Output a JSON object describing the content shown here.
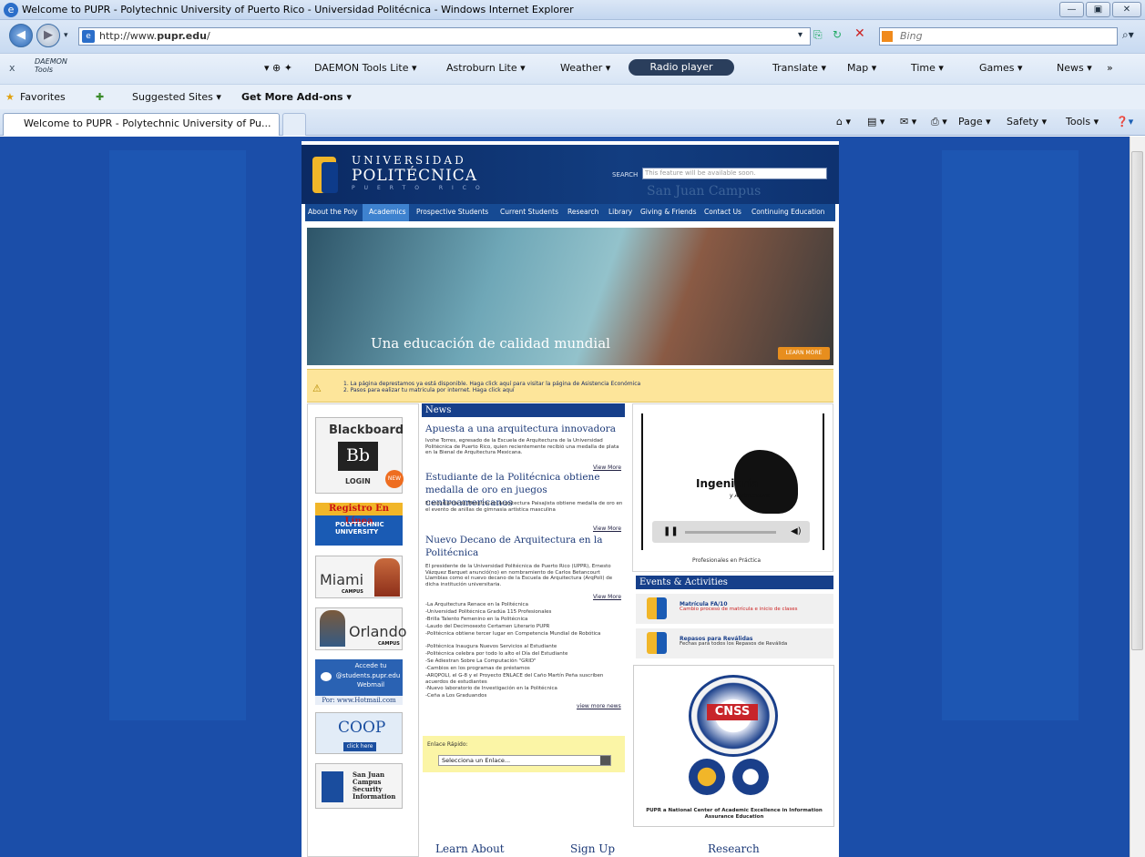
{
  "window": {
    "title": "Welcome to PUPR - Polytechnic University of Puerto Rico - Universidad Politécnica - Windows Internet Explorer"
  },
  "address": {
    "url_prefix": "http://www.",
    "url_domain": "pupr.edu",
    "url_suffix": "/",
    "search_placeholder": "Bing"
  },
  "toolbar": {
    "close": "x",
    "daemon_logo": "DAEMON Tools",
    "daemon_lite": "DAEMON Tools Lite ▾",
    "astroburn": "Astroburn Lite ▾",
    "weather": "Weather ▾",
    "radio": "Radio player",
    "translate": "Translate ▾",
    "map": "Map ▾",
    "time": "Time ▾",
    "games": "Games ▾",
    "news": "News ▾",
    "more": "»"
  },
  "favorites": {
    "favorites": "Favorites",
    "suggested": "Suggested Sites ▾",
    "addons": "Get More Add-ons ▾"
  },
  "tabs": [
    {
      "label": "Welcome to PUPR - Polytechnic University of Pu..."
    }
  ],
  "commandbar": {
    "page": "Page ▾",
    "safety": "Safety ▾",
    "tools": "Tools ▾"
  },
  "site": {
    "univ_line1": "UNIVERSIDAD",
    "univ_line2": "POLITÉCNICA",
    "univ_line3": "PUERTO RICO",
    "search_label": "SEARCH",
    "search_placeholder": "This feature will be available soon.",
    "campus": "San Juan Campus",
    "nav": [
      "About the Poly",
      "Academics",
      "Prospective Students",
      "Current Students",
      "Research",
      "Library",
      "Giving & Friends",
      "Contact Us",
      "Continuing Education"
    ],
    "hero_caption": "Una educación de calidad mundial",
    "hero_button": "LEARN MORE",
    "notice": [
      "1.  La página deprestamos ya está disponible. Haga click aquí para visitar la página de Asistencia Económica",
      "2.  Pasos para ealizar tu matricula por internet. Haga click aquí"
    ],
    "left": {
      "blackboard": "Blackboard",
      "bb": "Bb",
      "login": "LOGIN",
      "new": "NEW",
      "registro": "Registro En Línea",
      "registro_sub": "POLYTECHNIC UNIVERSITY",
      "miami": "Miami",
      "miami_campus": "CAMPUS",
      "orlando": "Orlando",
      "orlando_campus": "CAMPUS",
      "students_line1": "Accede tu",
      "students_line2": "@students.pupr.edu",
      "students_line3": "Webmail",
      "hotmail": "Por: www.Hotmail.com",
      "coop": "COOP",
      "coop_click": "click here",
      "security": "San Juan Campus Security Information"
    },
    "news": {
      "heading": "News",
      "items": [
        {
          "title": "Apuesta a una arquitectura innovadora",
          "body": "Ivohe Torres, egresado de la Escuela de Arquitectura de la Universidad Politécnica de Puerto Rico, quien recientemente recibió una medalla de plata en la Bienal de Arquitectura Mexicana.",
          "more": "View More"
        },
        {
          "title": "Estudiante de la Politécnica obtiene medalla de oro en juegos centroamericanos",
          "body": "El estudiante de Maestría en Arquitectura Paisajista obtiene medalla de oro en el evento de anillas de gimnasia artística masculina",
          "more": "View More"
        },
        {
          "title": "Nuevo Decano de Arquitectura en la Politécnica",
          "body": "El presidente de la Universidad Politécnica de Puerto Rico (UPPR), Ernesto Vázquez Barquet anunció(no) en nombramiento de Carlos Betancourt Llambias como el nuevo decano de la Escuela de Arquitectura (ArqPoli) de dicha institución universitaria.",
          "more": "View More"
        }
      ],
      "list": [
        "-La Arquitectura Renace en la Politécnica",
        "-Universidad Politécnica Gradúa 115 Profesionales",
        "-Brilla Talento Femenino en la Politécnica",
        "-Laudo del Decimosexto Certamen Literario PUPR",
        "-Politécnica obtiene tercer lugar en Competencia Mundial de Robótica",
        "-Politécnica Inaugura Nuevos Servicios al Estudiante",
        "-Politécnica celebra por todo lo alto el Día del Estudiante",
        "-Se Adiestran Sobre La Computación \"GRID\"",
        "-Cambios en los programas de préstamos",
        "-ARQPOLI, el G-8 y el Proyecto ENLACE del Caño Martín Peña suscriben acuerdos de estudiantes",
        "-Nuevo laboratorio de Investigación en la Politécnica",
        "-Ceña a Los Graduandos"
      ],
      "view_more_news": "view more news",
      "enlace_label": "Enlace Rápido:",
      "enlace_select": "Selecciona un Enlace..."
    },
    "video": {
      "title": "Ingeniería",
      "subtitle": "y Agrimensura",
      "caption": "Profesionales en Práctica",
      "play": "❚❚",
      "speaker": "◀)"
    },
    "events": {
      "heading": "Events & Activities",
      "items": [
        {
          "title": "Matrícula FA/10",
          "desc": "Cambio proceso de matrícula e inicio de clases"
        },
        {
          "title": "Repasos para Reválidas",
          "desc": "Fechas para todos los Repasos de Reválida"
        }
      ]
    },
    "cnss": {
      "badge": "CNSS",
      "caption": "PUPR a National Center of Academic Excellence in Information Assurance Education"
    },
    "bottom": {
      "learn": "Learn About",
      "signup": "Sign Up",
      "research": "Research"
    }
  }
}
